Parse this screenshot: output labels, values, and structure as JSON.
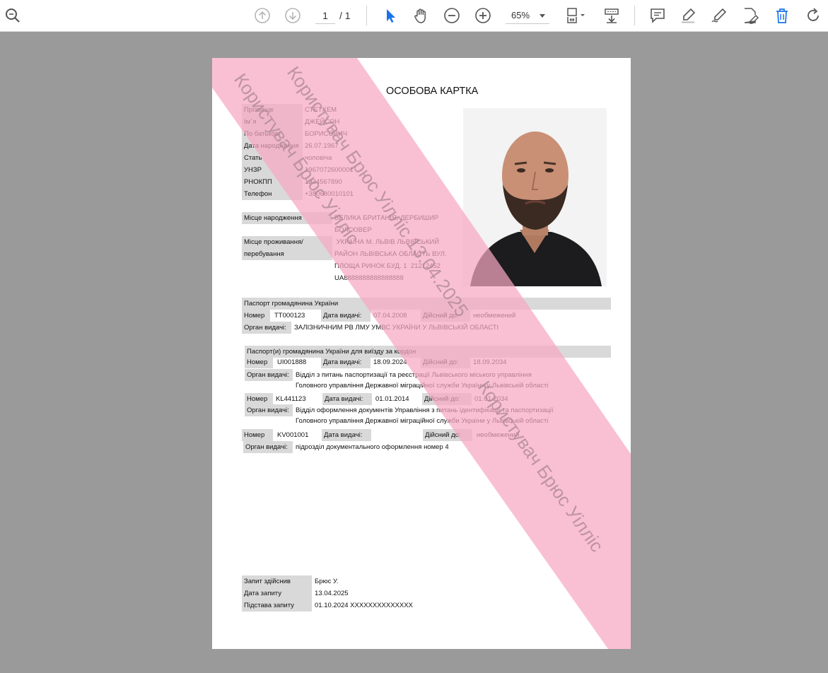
{
  "toolbar": {
    "page_current": "1",
    "page_total": "/ 1",
    "zoom": "65%",
    "accent_color": "#1a73e8"
  },
  "document": {
    "title": "ОСОБОВА КАРТКА",
    "personal": [
      {
        "label": "Прізвище",
        "value": "СТЕТХЕМ"
      },
      {
        "label": "Ім`я",
        "value": "ДЖЕЙСОН"
      },
      {
        "label": "По батькові",
        "value": "БОРИСОВИЧ"
      },
      {
        "label": "Дата народження",
        "value": "26.07.1967"
      },
      {
        "label": "Стать",
        "value": "чоловіча"
      },
      {
        "label": "УНЗР",
        "value": "1967072600001"
      },
      {
        "label": "РНОКПП",
        "value": "1234567890"
      },
      {
        "label": "Телефон",
        "value": "+380680010101"
      }
    ],
    "birth_place": {
      "label": "Місце народження",
      "lines": [
        "ВЕЛИКА БРИТАНІЯ, ДЕРБИШИР",
        "БОЛСОВЕР"
      ]
    },
    "residence": {
      "label_lines": [
        "Місце проживання/",
        "перебування"
      ],
      "lines": [
        " УКРАЇНА М. ЛЬВІВ ЛЬВІВСЬКИЙ",
        "РАЙОН ЛЬВІВСЬКА ОБЛАСТЬ ВУЛ.",
        "ПЛОЩА РИНОК БУД. 1  21212452",
        "UA8888888888888888"
      ]
    },
    "passport": {
      "header": "Паспорт громадянина України",
      "number_label": "Номер",
      "number": "ТТ000123",
      "issued_label": "Дата видачі:",
      "issued": "07.04.2008",
      "valid_label": "Дійсний до:",
      "valid": "необмежений",
      "authority_label": "Орган видачі:",
      "authority": "ЗАЛІЗНИЧНИМ РВ ЛМУ УМВС УКРАЇНИ У ЛЬВІВСЬКІЙ ОБЛАСТІ"
    },
    "foreign": {
      "header": "Паспорт(и) громадянина України для виїзду за кордон",
      "number_label": "Номер",
      "issued_label": "Дата видачі:",
      "valid_label": "Дійсний до:",
      "authority_label": "Орган видачі:",
      "items": [
        {
          "number": "UI001888",
          "issued": "18.09.2024",
          "valid": "18.09.2034",
          "authority_lines": [
            "Відділ з питань паспортизації та реєстрації Львівського міського управління",
            "Головного управління Державної міграційної служби України у Львівській області"
          ]
        },
        {
          "number": "KL441123",
          "issued": "01.01.2014",
          "valid": "01.01.2034",
          "authority_lines": [
            "Відділ оформлення документів Управління з питань ідентифікації та паспортизації",
            "Головного управління Державної міграційної служби України у Львівській області"
          ]
        },
        {
          "number": "KV001001",
          "issued": "",
          "valid": "необмежений",
          "authority_lines": [
            "підрозділ документального оформлення номер 4"
          ]
        }
      ]
    },
    "request": [
      {
        "label": "Запит здійснив",
        "value": "Брюс У."
      },
      {
        "label": "Дата запиту",
        "value": "13.04.2025"
      },
      {
        "label": "Підстава запиту",
        "value": "01.10.2024 XXXXXXXXXXXXXX"
      }
    ],
    "watermark": {
      "color": "#f7a8c2",
      "lines": [
        "Користувач Брюс Уілліс",
        "Користувач Брюс Уілліс 13.04.2025",
        "Користувач Брюс Уілліс"
      ]
    }
  }
}
